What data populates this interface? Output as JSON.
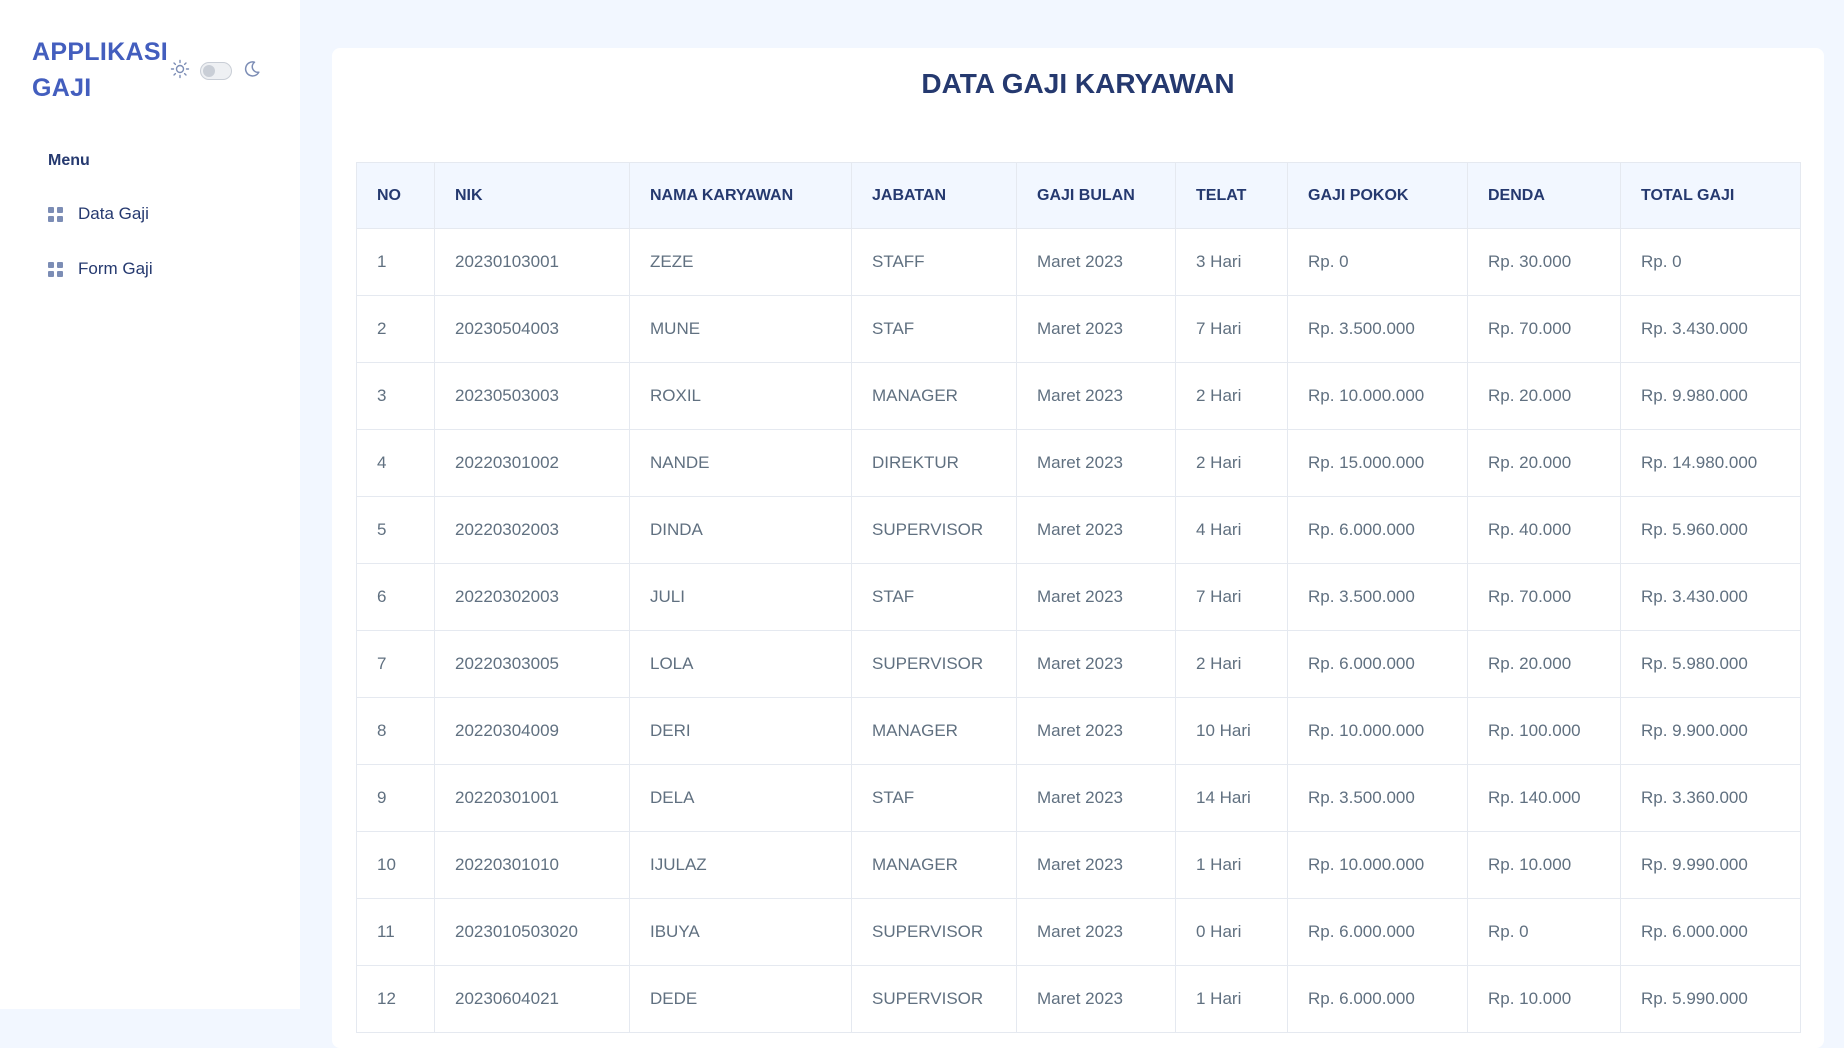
{
  "sidebar": {
    "brand": "APPLIKASI GAJI",
    "menu_title": "Menu",
    "items": [
      {
        "label": "Data Gaji",
        "icon": "grid-icon"
      },
      {
        "label": "Form Gaji",
        "icon": "grid-icon"
      }
    ]
  },
  "main": {
    "title": "DATA GAJI KARYAWAN",
    "columns": [
      "NO",
      "NIK",
      "NAMA KARYAWAN",
      "JABATAN",
      "GAJI BULAN",
      "TELAT",
      "GAJI POKOK",
      "DENDA",
      "TOTAL GAJI"
    ],
    "rows": [
      [
        "1",
        "20230103001",
        "ZEZE",
        "STAFF",
        "Maret 2023",
        "3 Hari",
        "Rp. 0",
        "Rp. 30.000",
        "Rp. 0"
      ],
      [
        "2",
        "20230504003",
        "MUNE",
        "STAF",
        "Maret 2023",
        "7 Hari",
        "Rp. 3.500.000",
        "Rp. 70.000",
        "Rp. 3.430.000"
      ],
      [
        "3",
        "20230503003",
        "ROXIL",
        "MANAGER",
        "Maret 2023",
        "2 Hari",
        "Rp. 10.000.000",
        "Rp. 20.000",
        "Rp. 9.980.000"
      ],
      [
        "4",
        "20220301002",
        "NANDE",
        "DIREKTUR",
        "Maret 2023",
        "2 Hari",
        "Rp. 15.000.000",
        "Rp. 20.000",
        "Rp. 14.980.000"
      ],
      [
        "5",
        "20220302003",
        "DINDA",
        "SUPERVISOR",
        "Maret 2023",
        "4 Hari",
        "Rp. 6.000.000",
        "Rp. 40.000",
        "Rp. 5.960.000"
      ],
      [
        "6",
        "20220302003",
        "JULI",
        "STAF",
        "Maret 2023",
        "7 Hari",
        "Rp. 3.500.000",
        "Rp. 70.000",
        "Rp. 3.430.000"
      ],
      [
        "7",
        "20220303005",
        "LOLA",
        "SUPERVISOR",
        "Maret 2023",
        "2 Hari",
        "Rp. 6.000.000",
        "Rp. 20.000",
        "Rp. 5.980.000"
      ],
      [
        "8",
        "20220304009",
        "DERI",
        "MANAGER",
        "Maret 2023",
        "10 Hari",
        "Rp. 10.000.000",
        "Rp. 100.000",
        "Rp. 9.900.000"
      ],
      [
        "9",
        "20220301001",
        "DELA",
        "STAF",
        "Maret 2023",
        "14 Hari",
        "Rp. 3.500.000",
        "Rp. 140.000",
        "Rp. 3.360.000"
      ],
      [
        "10",
        "20220301010",
        "IJULAZ",
        "MANAGER",
        "Maret 2023",
        "1 Hari",
        "Rp. 10.000.000",
        "Rp. 10.000",
        "Rp. 9.990.000"
      ],
      [
        "11",
        "2023010503020",
        "IBUYA",
        "SUPERVISOR",
        "Maret 2023",
        "0 Hari",
        "Rp. 6.000.000",
        "Rp. 0",
        "Rp. 6.000.000"
      ],
      [
        "12",
        "20230604021",
        "DEDE",
        "SUPERVISOR",
        "Maret 2023",
        "1 Hari",
        "Rp. 6.000.000",
        "Rp. 10.000",
        "Rp. 5.990.000"
      ]
    ]
  },
  "theme": {
    "accent": "#435ebe",
    "heading": "#25396f",
    "text": "#607080",
    "background": "#f2f7ff",
    "icons": [
      "sun-icon",
      "theme-toggle-switch",
      "moon-icon"
    ]
  }
}
